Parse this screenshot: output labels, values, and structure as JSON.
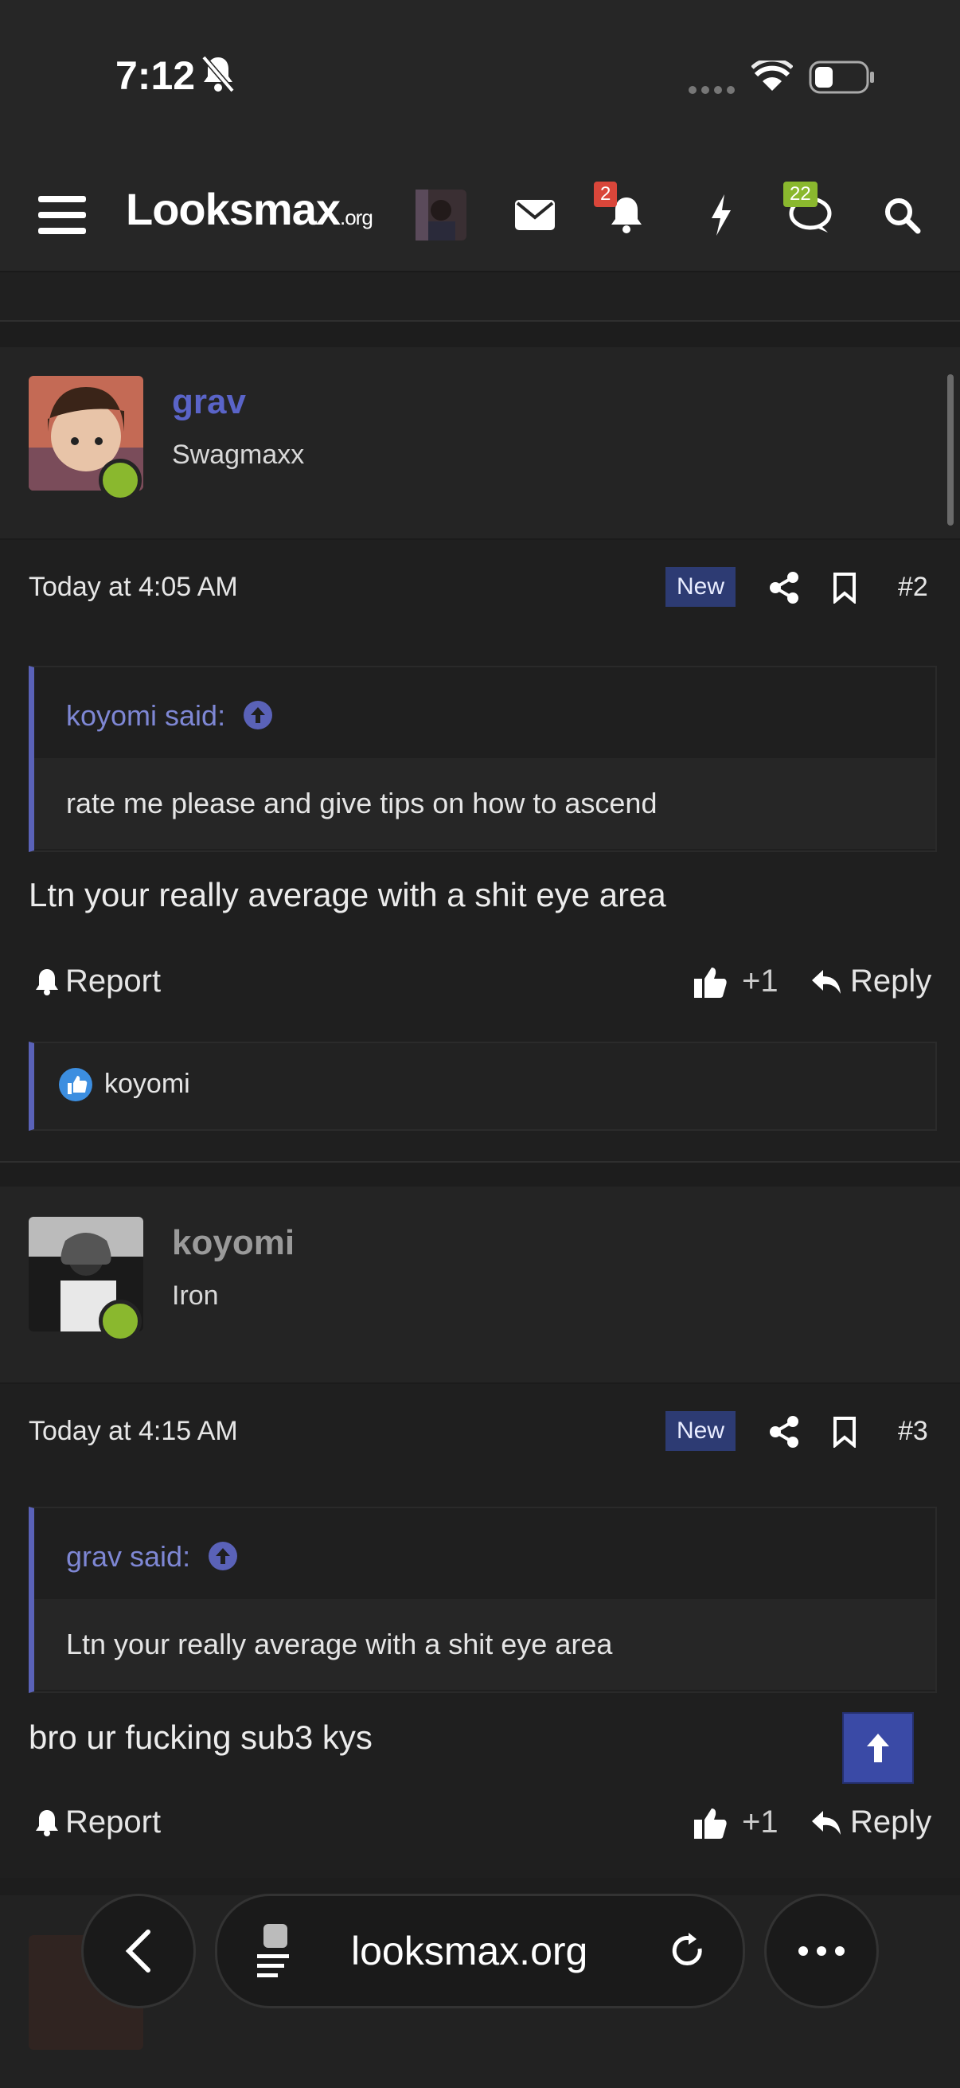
{
  "status": {
    "time": "7:12"
  },
  "header": {
    "logo_main": "Looksmax",
    "logo_suffix": ".org",
    "notifications_count": "2",
    "conversations_count": "22"
  },
  "posts": [
    {
      "username": "grav",
      "user_title": "Swagmaxx",
      "date": "Today at 4:05 AM",
      "new_label": "New",
      "post_number": "#2",
      "quote_author": "koyomi said:",
      "quote_text": "rate me please and give tips on how to ascend",
      "message": "Ltn your really average with a shit eye area",
      "report_label": "Report",
      "like_count": "+1",
      "reply_label": "Reply",
      "reaction_user": "koyomi",
      "username_color": "#5a64c8"
    },
    {
      "username": "koyomi",
      "user_title": "Iron",
      "date": "Today at 4:15 AM",
      "new_label": "New",
      "post_number": "#3",
      "quote_author": "grav said:",
      "quote_text": "Ltn your really average with a shit eye area",
      "message": "bro ur fucking sub3 kys",
      "report_label": "Report",
      "like_count": "+1",
      "reply_label": "Reply",
      "username_color": "#9a9a9a"
    }
  ],
  "browser": {
    "url": "looksmax.org"
  },
  "colors": {
    "accent": "#5a62b8",
    "online": "#8ab82e",
    "badge_red": "#d9463a",
    "badge_green": "#8ab82e"
  }
}
